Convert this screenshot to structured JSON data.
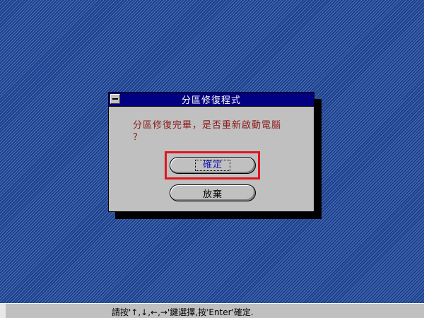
{
  "dialog": {
    "title": "分區修復程式",
    "message_line1": "分區修復完畢，是否重新啟動電腦",
    "message_line2": "？",
    "ok_label": "確定",
    "cancel_label": "放棄"
  },
  "status_bar": {
    "text": "請按'↑,↓,←,→'鍵選擇,按'Enter'確定."
  },
  "colors": {
    "desktop": "#1c3f8c",
    "title_bar": "#000080",
    "dialog_bg": "#c0c0c0",
    "message_text": "#8b1a1a",
    "ok_text": "#1a1ab0",
    "highlight": "#e0141e"
  },
  "icons": {
    "system_menu": "system-menu-icon"
  }
}
